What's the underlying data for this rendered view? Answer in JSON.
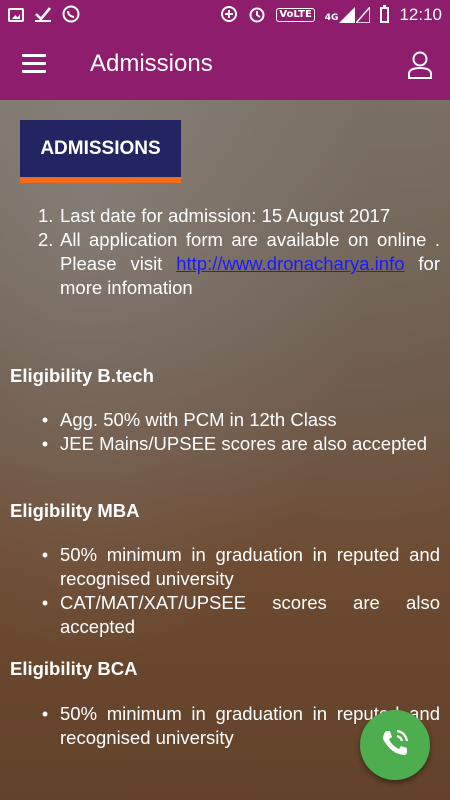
{
  "status_bar": {
    "volte": "VoLTE",
    "network": "4G",
    "time": "12:10"
  },
  "app_bar": {
    "title": "Admissions"
  },
  "badge": {
    "label": "ADMISSIONS"
  },
  "notices": [
    {
      "num": "1.",
      "text": "Last date for admission: 15 August 2017"
    },
    {
      "num": "2.",
      "text_before": "All application form are available on online . Please visit ",
      "link": "http://www.dronacharya.info",
      "text_after": " for more infomation"
    }
  ],
  "sections": [
    {
      "heading": "Eligibility B.tech",
      "items": [
        "Agg. 50% with PCM in 12th Class",
        "JEE Mains/UPSEE scores are also accepted"
      ]
    },
    {
      "heading": "Eligibility MBA",
      "items": [
        "50% minimum in graduation in reputed and recognised university",
        "CAT/MAT/XAT/UPSEE scores are also accepted"
      ]
    },
    {
      "heading": "Eligibility BCA",
      "items": [
        "50% minimum in graduation in reputed and recognised university"
      ]
    }
  ],
  "colors": {
    "app_bar": "#8e1d6e",
    "badge_bg": "#232462",
    "badge_underline": "#f26a1b",
    "fab": "#4cae4f",
    "link": "#1a1aff"
  },
  "icons": [
    "gallery-icon",
    "check-icon",
    "whatsapp-icon",
    "data-saver-icon",
    "alarm-icon",
    "signal-icon",
    "battery-icon",
    "menu-icon",
    "user-icon",
    "phone-icon"
  ]
}
